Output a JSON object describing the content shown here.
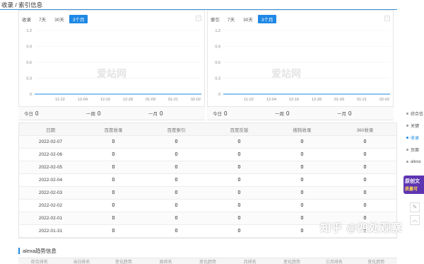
{
  "header": {
    "title": "收录 / 索引信息"
  },
  "panels": {
    "left": {
      "label": "收录",
      "tabs": [
        "7天",
        "30天",
        "3个月"
      ],
      "active_tab": "3个月",
      "arrow": "›",
      "watermark": "爱站网",
      "summary": [
        {
          "label": "今日",
          "value": "0"
        },
        {
          "label": "一周",
          "value": "0"
        },
        {
          "label": "一月",
          "value": "0"
        }
      ]
    },
    "right": {
      "label": "索引",
      "tabs": [
        "7天",
        "30天",
        "3个月"
      ],
      "active_tab": "3个月",
      "arrow": "›",
      "watermark": "爱站网",
      "summary": [
        {
          "label": "今日",
          "value": "0"
        },
        {
          "label": "一周",
          "value": "0"
        },
        {
          "label": "一月",
          "value": "0"
        }
      ]
    }
  },
  "chart_data": [
    {
      "type": "line",
      "x": [
        "11-22",
        "12-04",
        "12-16",
        "12-28",
        "01-09",
        "01-21",
        "02-02"
      ],
      "series": [
        {
          "values": [
            0,
            0,
            0,
            0,
            0,
            0,
            0
          ]
        }
      ],
      "yticks": [
        "1.2",
        "0.9",
        "0.6",
        "0.3",
        "0"
      ],
      "ylim": [
        0,
        1.2
      ],
      "grid": true,
      "line_color": "#1e88e5"
    },
    {
      "type": "line",
      "x": [
        "11-22",
        "12-04",
        "12-16",
        "12-28",
        "01-09",
        "01-21",
        "02-02"
      ],
      "series": [
        {
          "values": [
            0,
            0,
            0,
            0,
            0,
            0,
            0
          ]
        }
      ],
      "yticks": [
        "1.2",
        "0.9",
        "0.6",
        "0.3",
        "0"
      ],
      "ylim": [
        0,
        1.2
      ],
      "grid": true,
      "line_color": "#1e88e5"
    }
  ],
  "table": {
    "columns": [
      "日期",
      "百度收录",
      "百度索引",
      "百度反链",
      "搜狗收录",
      "360收录"
    ],
    "rows": [
      [
        "2022-02-07",
        "0",
        "0",
        "0",
        "0",
        "0"
      ],
      [
        "2022-02-06",
        "0",
        "0",
        "0",
        "0",
        "0"
      ],
      [
        "2022-02-05",
        "0",
        "0",
        "0",
        "0",
        "0"
      ],
      [
        "2022-02-04",
        "0",
        "0",
        "0",
        "0",
        "0"
      ],
      [
        "2022-02-03",
        "0",
        "0",
        "0",
        "0",
        "0"
      ],
      [
        "2022-02-02",
        "0",
        "0",
        "0",
        "0",
        "0"
      ],
      [
        "2022-02-01",
        "0",
        "0",
        "0",
        "0",
        "0"
      ],
      [
        "2022-01-31",
        "0",
        "0",
        "0",
        "0",
        "0"
      ]
    ]
  },
  "alexa": {
    "title": "alexa趋势信息",
    "columns": [
      "综合排名",
      "当日排名",
      "变化趋势",
      "周排名",
      "变化趋势",
      "月排名",
      "变化趋势",
      "三月排名",
      "变化趋势"
    ]
  },
  "side_nav": {
    "items": [
      "综合信",
      "关键",
      "收录",
      "页面",
      "alexa"
    ],
    "active_index": 2
  },
  "promo": {
    "line1": "原创文",
    "line2": "质量可"
  },
  "tools": {
    "edit": "✎",
    "top": "︿"
  },
  "brand": "知乎 @四处观察",
  "colors": {
    "accent": "#1e88e5",
    "promo": "#5e35b1"
  }
}
